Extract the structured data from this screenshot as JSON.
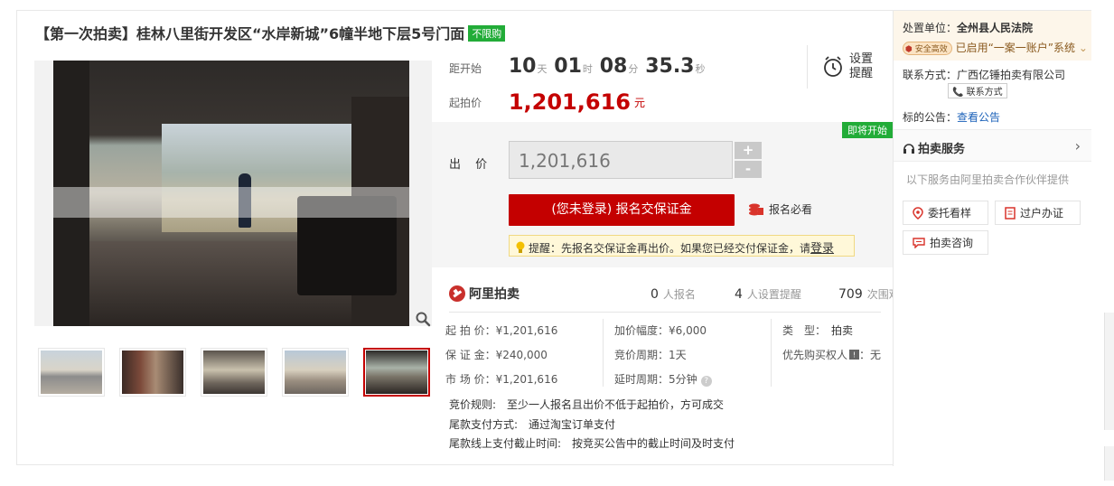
{
  "title": {
    "text": "【第一次拍卖】桂林八里街开发区“水岸新城”6幢半地下层5号门面",
    "badge": "不限购"
  },
  "countdown": {
    "label": "距开始",
    "days": "10",
    "days_unit": "天",
    "hours": "01",
    "hours_unit": "时",
    "minutes": "08",
    "minutes_unit": "分",
    "seconds": "35.3",
    "seconds_unit": "秒"
  },
  "remind": {
    "icon": "alarm-clock-icon",
    "label": "设置提醒"
  },
  "start_price": {
    "label": "起拍价",
    "value": "1,201,616",
    "unit": "元"
  },
  "bid": {
    "soon_badge": "即将开始",
    "label": "出 价",
    "value": "1,201,616",
    "plus": "+",
    "minus": "-",
    "signup_button": "(您未登录) 报名交保证金",
    "must_read": "报名必看",
    "tip_text": "提醒：先报名交保证金再出价。如果您已经交付保证金，请",
    "tip_login": "登录"
  },
  "stats": {
    "brand": "阿里拍卖",
    "signups_n": "0",
    "signups_label": "人报名",
    "reminders_n": "4",
    "reminders_label": "人设置提醒",
    "views_n": "709",
    "views_label": "次围观"
  },
  "info": {
    "start_price": "起 拍 价：¥1,201,616",
    "deposit": "保 证 金：¥240,000",
    "market_price": "市 场 价：¥1,201,616",
    "increment": "加价幅度：¥6,000",
    "cycle": "竞价周期：1天",
    "delay": "延时周期：5分钟",
    "type_label": "类　型：",
    "type_value": "拍卖",
    "priority": "优先购买权人",
    "priority_value": "：无"
  },
  "rules": {
    "rule_label": "竞价规则:",
    "rule_value": "至少一人报名且出价不低于起拍价，方可成交",
    "pay_label": "尾款支付方式:",
    "pay_value": "通过淘宝订单支付",
    "deadline_label": "尾款线上支付截止时间:",
    "deadline_value": "按竞买公告中的截止时间及时支付"
  },
  "right": {
    "court_label": "处置单位：",
    "court_value": "全州县人民法院",
    "safe_badge": "安全高效",
    "account_text": "已启用“一案一账户”系统",
    "contact_label": "联系方式：",
    "contact_value": "广西亿锤拍卖有限公司",
    "contact_button": "联系方式",
    "notice_label": "标的公告：",
    "notice_link": "查看公告",
    "service_title": "拍卖服务",
    "service_note": "以下服务由阿里拍卖合作伙伴提供",
    "svc_viewing": "委托看样",
    "svc_transfer": "过户办证",
    "svc_consult": "拍卖咨询"
  }
}
